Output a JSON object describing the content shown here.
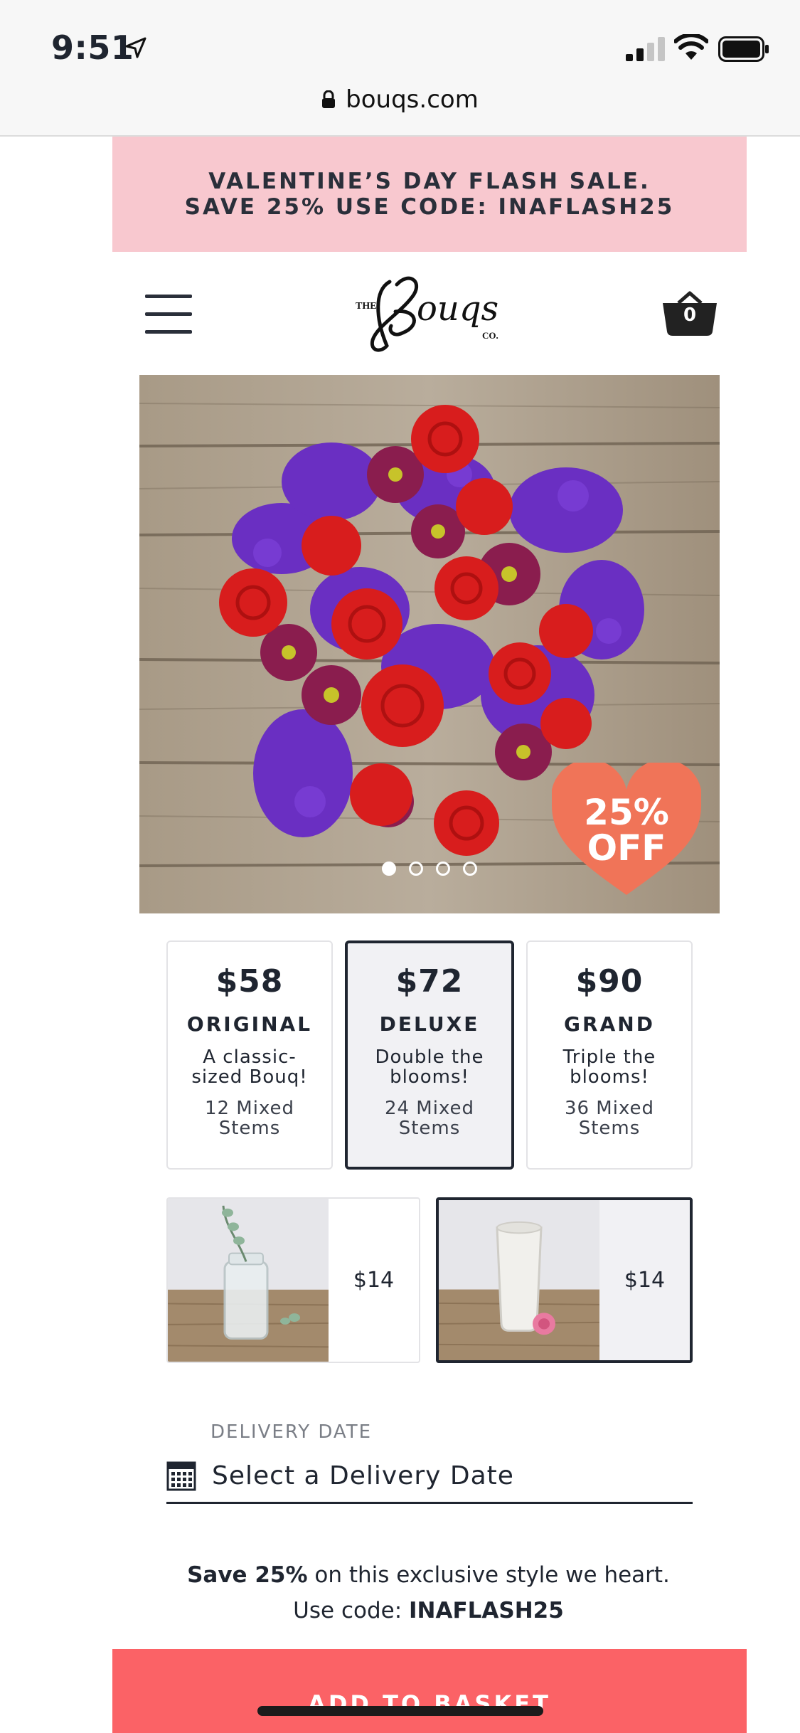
{
  "status_bar": {
    "time": "9:51",
    "icons": [
      "location-arrow-icon",
      "signal-icon",
      "wifi-icon",
      "battery-icon"
    ]
  },
  "browser": {
    "url": "bouqs.com",
    "icon": "lock-icon"
  },
  "promo": {
    "line1": "VALENTINE’S DAY FLASH SALE.",
    "line2_prefix": "SAVE 25% USE CODE: ",
    "line2_code": "INAFLASH25"
  },
  "header": {
    "menu_icon": "hamburger-menu-icon",
    "logo_icon": "bouqs-logo-icon",
    "cart_icon": "basket-icon",
    "cart_count": "0"
  },
  "hero": {
    "badge_line1": "25%",
    "badge_line2": "OFF",
    "carousel_pages": 4,
    "carousel_active": 1
  },
  "sizes": [
    {
      "price": "$58",
      "name": "ORIGINAL",
      "desc": "A classic-sized Bouq!",
      "stems": "12 Mixed Stems",
      "selected": false
    },
    {
      "price": "$72",
      "name": "DELUXE",
      "desc": "Double the blooms!",
      "stems": "24 Mixed Stems",
      "selected": true
    },
    {
      "price": "$90",
      "name": "GRAND",
      "desc": "Triple the blooms!",
      "stems": "36 Mixed Stems",
      "selected": false
    }
  ],
  "vases": [
    {
      "price": "$14",
      "selected": false
    },
    {
      "price": "$14",
      "selected": true
    }
  ],
  "delivery": {
    "label": "DELIVERY DATE",
    "placeholder": "Select a Delivery Date",
    "icon": "calendar-icon"
  },
  "promo_note": {
    "save_bold": "Save 25%",
    "save_rest": " on this exclusive style we heart.",
    "code_prefix": "Use code: ",
    "code": "INAFLASH25"
  },
  "cta": {
    "label": "ADD TO BASKET"
  },
  "colors": {
    "accent": "#fb6266",
    "promo_bg": "#f8c8cf",
    "dark": "#1f2530"
  }
}
